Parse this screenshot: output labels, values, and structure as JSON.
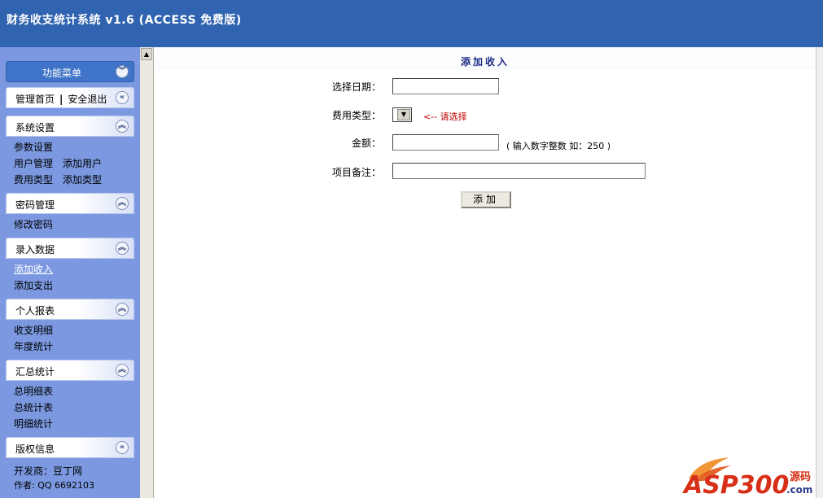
{
  "header": {
    "title": "财务收支统计系统 v1.6 (ACCESS 免费版)"
  },
  "sidebar": {
    "menu_title": "功能菜单",
    "top_links": {
      "home": "管理首页",
      "sep": "|",
      "logout": "安全退出"
    },
    "sections": [
      {
        "title": "系统设置",
        "rows": [
          [
            "参数设置"
          ],
          [
            "用户管理",
            "添加用户"
          ],
          [
            "费用类型",
            "添加类型"
          ]
        ]
      },
      {
        "title": "密码管理",
        "rows": [
          [
            "修改密码"
          ]
        ]
      },
      {
        "title": "录入数据",
        "rows": [
          [
            "添加收入"
          ],
          [
            "添加支出"
          ]
        ]
      },
      {
        "title": "个人报表",
        "rows": [
          [
            "收支明细"
          ],
          [
            "年度统计"
          ]
        ]
      },
      {
        "title": "汇总统计",
        "rows": [
          [
            "总明细表"
          ],
          [
            "总统计表"
          ],
          [
            "明细统计"
          ]
        ]
      },
      {
        "title": "版权信息",
        "rows": [
          [
            "开发商：豆丁网"
          ],
          [
            "作者: QQ 6692103"
          ]
        ]
      }
    ]
  },
  "form": {
    "title": "添加收入",
    "date_label": "选择日期：",
    "date_value": "",
    "type_label": "费用类型：",
    "type_hint": "<-- 请选择",
    "amount_label": "金额：",
    "amount_value": "",
    "amount_hint": "( 输入数字整数  如：250 )",
    "note_label": "项目备注：",
    "note_value": "",
    "submit_label": "添加"
  },
  "watermark": {
    "text": "ASP300",
    "sub": "源码",
    "domain": ".com"
  },
  "colors": {
    "header": "#3064b0",
    "sidebar": "#7b98e0",
    "title": "#1c2c86",
    "hint": "#c00000"
  }
}
